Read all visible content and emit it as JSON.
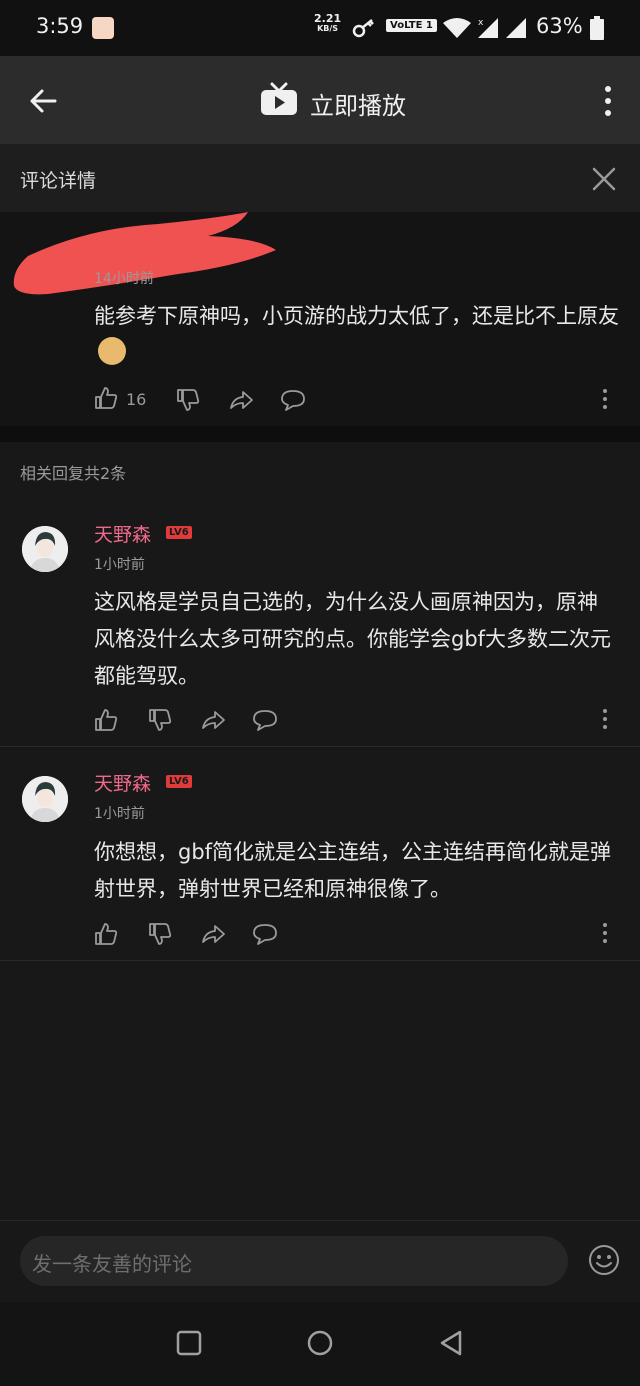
{
  "status_bar": {
    "time": "3:59",
    "net_speed_value": "2.21",
    "net_speed_unit": "KB/S",
    "volte": "VoLTE 1",
    "battery": "63%"
  },
  "app_bar": {
    "title": "立即播放"
  },
  "detail_header": {
    "title": "评论详情"
  },
  "main_comment": {
    "time": "14小时前",
    "text": "能参考下原神吗，小页游的战力太低了，还是比不上原友",
    "emoji": "doge",
    "likes": "16"
  },
  "replies_header": "相关回复共2条",
  "replies": [
    {
      "username": "天野森",
      "level": "LV6",
      "time": "1小时前",
      "text": "这风格是学员自己选的，为什么没人画原神因为，原神风格没什么太多可研究的点。你能学会gbf大多数二次元都能驾驭。"
    },
    {
      "username": "天野森",
      "level": "LV6",
      "time": "1小时前",
      "text": "你想想，gbf简化就是公主连结，公主连结再简化就是弹射世界，弹射世界已经和原神很像了。"
    }
  ],
  "composer": {
    "placeholder": "发一条友善的评论"
  },
  "colors": {
    "username": "#ef6a8a",
    "level_badge": "#e03b3b",
    "background": "#181818"
  }
}
